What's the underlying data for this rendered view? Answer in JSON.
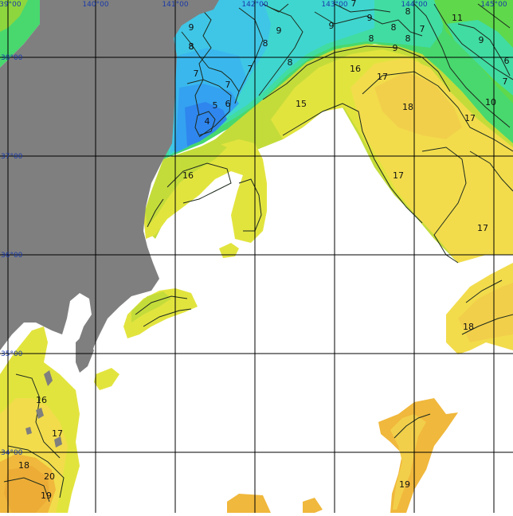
{
  "map": {
    "longitude_labels": [
      "139°00",
      "140°00",
      "141°00",
      "142°00",
      "143°00",
      "144°00",
      "145°00"
    ],
    "latitude_labels": [
      "39°00",
      "38°00",
      "37°00",
      "36°00",
      "35°00",
      "34°00"
    ],
    "colors": {
      "land": "#7f7f7f",
      "no_data": "#ffffff",
      "grid": "#000000",
      "coord_label": "#1a3aa8",
      "t4": "#2f86ee",
      "t5": "#34a2f0",
      "t6": "#3ab8ee",
      "t7": "#3fc6e6",
      "t8": "#3fd6cf",
      "t9": "#41dca2",
      "t10": "#48d86e",
      "t11": "#5fd84b",
      "t12": "#8ed63e",
      "t15": "#c4dc3a",
      "t16": "#e2e43e",
      "t17": "#f2dc4c",
      "t18": "#f2cf4a",
      "t19": "#f0b83c",
      "t20": "#ecac36"
    },
    "isotherm_labels": [
      {
        "t": "9"
      },
      {
        "t": "8"
      },
      {
        "t": "7"
      },
      {
        "t": "9"
      },
      {
        "t": "8"
      },
      {
        "t": "8"
      },
      {
        "t": "7"
      },
      {
        "t": "9"
      },
      {
        "t": "9"
      },
      {
        "t": "8"
      },
      {
        "t": "7"
      },
      {
        "t": "8"
      },
      {
        "t": "9"
      },
      {
        "t": "8"
      },
      {
        "t": "8"
      },
      {
        "t": "7"
      },
      {
        "t": "11"
      },
      {
        "t": "9"
      },
      {
        "t": "6"
      },
      {
        "t": "7"
      },
      {
        "t": "10"
      },
      {
        "t": "7"
      },
      {
        "t": "6"
      },
      {
        "t": "5"
      },
      {
        "t": "4"
      },
      {
        "t": "8"
      },
      {
        "t": "15"
      },
      {
        "t": "16"
      },
      {
        "t": "17"
      },
      {
        "t": "18"
      },
      {
        "t": "17"
      },
      {
        "t": "17"
      },
      {
        "t": "17"
      },
      {
        "t": "16"
      },
      {
        "t": "18"
      },
      {
        "t": "16"
      },
      {
        "t": "17"
      },
      {
        "t": "18"
      },
      {
        "t": "20"
      },
      {
        "t": "19"
      },
      {
        "t": "19"
      }
    ]
  }
}
